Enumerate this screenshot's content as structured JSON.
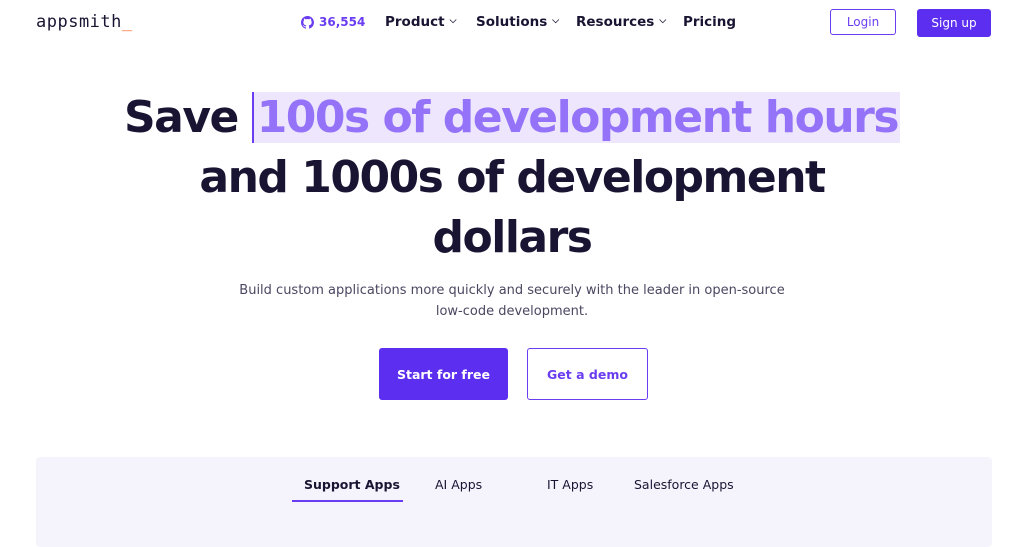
{
  "header": {
    "logo": "appsmith",
    "logo_cursor": "_",
    "github_stars": "36,554",
    "nav": [
      {
        "label": "Product"
      },
      {
        "label": "Solutions"
      },
      {
        "label": "Resources"
      },
      {
        "label": "Pricing"
      }
    ],
    "login_label": "Login",
    "signup_label": "Sign up"
  },
  "hero": {
    "line1_prefix": "Save",
    "line1_highlight": "100s of development hours",
    "line2": "and 1000s of development",
    "line3": "dollars",
    "subtitle": "Build custom applications more quickly and securely with the leader in open-source low-code development.",
    "primary_cta": "Start for free",
    "secondary_cta": "Get a demo"
  },
  "tabs": [
    {
      "label": "Support Apps",
      "active": true
    },
    {
      "label": "AI Apps",
      "active": false
    },
    {
      "label": "IT Apps",
      "active": false
    },
    {
      "label": "Salesforce Apps",
      "active": false
    }
  ],
  "colors": {
    "brand": "#5b2ef0",
    "highlight_text": "#9473f8",
    "highlight_bg": "#ede6fd",
    "logo_cursor": "#f86a2b",
    "panel_bg": "#f5f3fc"
  }
}
